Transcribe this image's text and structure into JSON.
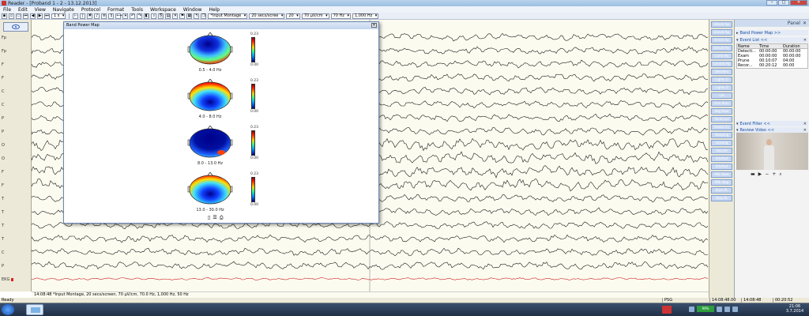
{
  "window": {
    "title": "Reader - [Proband 1 - 2 - 13.12.2013]"
  },
  "menu": [
    "File",
    "Edit",
    "View",
    "Navigate",
    "Protocol",
    "Format",
    "Tools",
    "Workspace",
    "Window",
    "Help"
  ],
  "toolbar": {
    "zoom_select": "1 s",
    "montage_select": "*Input Montage",
    "screen_select": "20 secs/scree",
    "channels_select": "20",
    "sensitivity_select": "70 µV/cm",
    "lowfilter_select": "70 Hz",
    "highfilter_select": "1,000 Hz"
  },
  "channels": [
    "Fp",
    "Fp",
    "F",
    "F",
    "C",
    "C",
    "P",
    "P",
    "O",
    "O",
    "F",
    "F",
    "T",
    "T",
    "T",
    "T",
    "C",
    "P",
    "EKG"
  ],
  "band_power_map": {
    "title": "Band Power Map",
    "maps": [
      {
        "label": "0.5 - 4.0 Hz",
        "max": "0.23",
        "min": "0.00"
      },
      {
        "label": "4.0 - 8.0 Hz",
        "max": "0.23",
        "min": "0.00"
      },
      {
        "label": "8.0 - 13.0 Hz",
        "max": "0.23",
        "min": "0.00"
      },
      {
        "label": "13.0 - 30.0 Hz",
        "max": "0.23",
        "min": "0.00"
      }
    ]
  },
  "right_buttons": [
    "Elevat Ap",
    "Elevat Ap",
    "Arrest Ap",
    "Elevat Hy",
    "Contr Hy",
    "Central Hy",
    "Decelera",
    "Lights O",
    "Lights O",
    "Lid",
    "Gen Arou",
    "Seg Arou",
    "Techincal",
    "Awake Ey",
    "Sleeping",
    "Leaving",
    "Seizure",
    "Artefact",
    "Artefact",
    "PRE Start",
    "PRE Stop",
    "Start PL",
    "Stop PL"
  ],
  "panel": {
    "title": "Panel",
    "sections": {
      "band_power": "Band Power Map >>",
      "event_list": "Event List <<",
      "event_filter": "Event Filter <<",
      "review_video": "Review Video <<"
    },
    "event_table": {
      "headers": [
        "Name",
        "Time",
        "Duration"
      ],
      "rows": [
        [
          "Detecti...",
          "00:00:00",
          "00:00:00"
        ],
        [
          "Exam",
          "00:00:00",
          "00:00:00"
        ],
        [
          "Prune",
          "00:10:07",
          "04:00"
        ],
        [
          "Recor...",
          "00:20:12",
          "00:00"
        ]
      ]
    }
  },
  "statusline": "14:08:48 *Input Montage, 20 secs/screen, 70 µV/cm, 70.0 Hz, 1,000 Hz, 50 Hz",
  "statusbar": {
    "ready": "Ready",
    "mode": "PSG",
    "time_range": "14:08:48.00",
    "time_pos": "14:08:48",
    "duration": "00:20:52"
  },
  "tray": {
    "battery": "99%",
    "time": "21:06",
    "date": "3.7.2014"
  },
  "colors": {
    "eeg_bg": "#fcfbf0",
    "trace": "#1a1a1a",
    "ekg_trace": "#cc2222",
    "button_bg": "#c7d8f2"
  }
}
